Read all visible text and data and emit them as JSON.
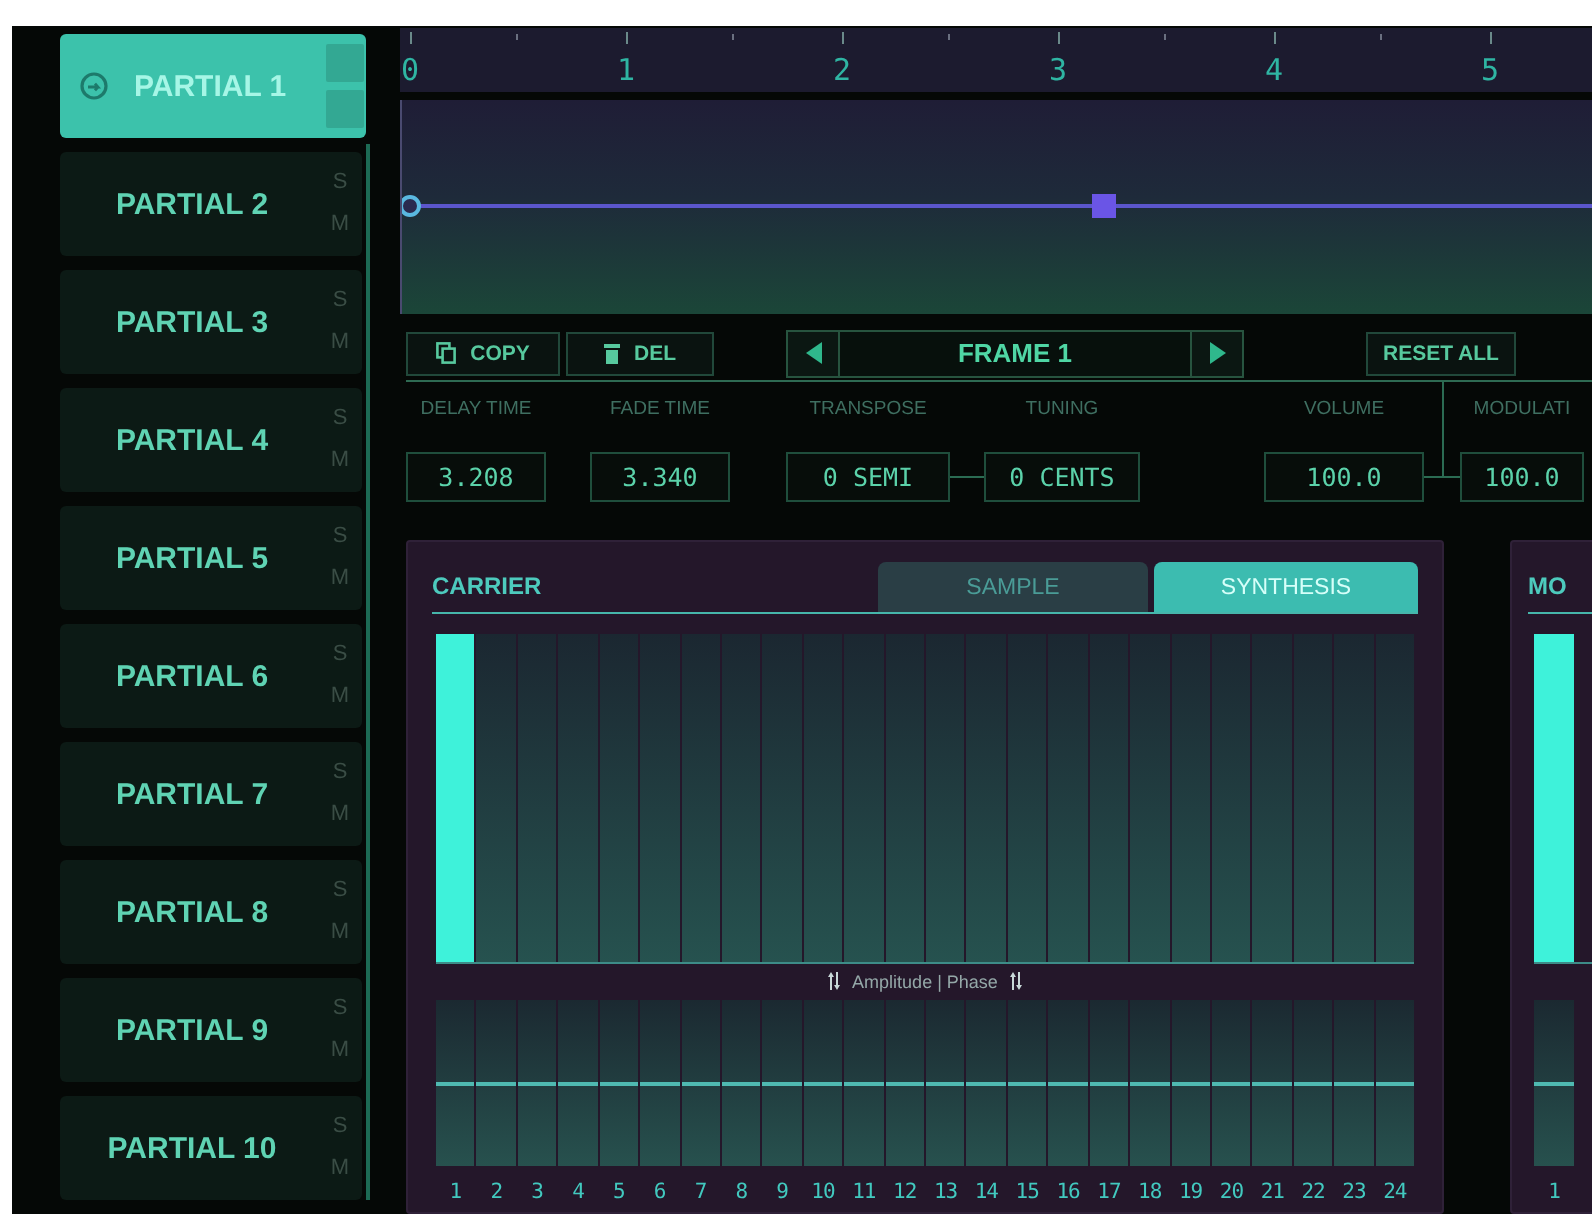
{
  "partials": [
    {
      "label": "PARTIAL 1",
      "selected": true
    },
    {
      "label": "PARTIAL 2",
      "selected": false,
      "toggles": [
        "S",
        "M"
      ]
    },
    {
      "label": "PARTIAL 3",
      "selected": false,
      "toggles": [
        "S",
        "M"
      ]
    },
    {
      "label": "PARTIAL 4",
      "selected": false,
      "toggles": [
        "S",
        "M"
      ]
    },
    {
      "label": "PARTIAL 5",
      "selected": false,
      "toggles": [
        "S",
        "M"
      ]
    },
    {
      "label": "PARTIAL 6",
      "selected": false,
      "toggles": [
        "S",
        "M"
      ]
    },
    {
      "label": "PARTIAL 7",
      "selected": false,
      "toggles": [
        "S",
        "M"
      ]
    },
    {
      "label": "PARTIAL 8",
      "selected": false,
      "toggles": [
        "S",
        "M"
      ]
    },
    {
      "label": "PARTIAL 9",
      "selected": false,
      "toggles": [
        "S",
        "M"
      ]
    },
    {
      "label": "PARTIAL 10",
      "selected": false,
      "toggles": [
        "S",
        "M"
      ]
    }
  ],
  "ruler": {
    "ticks": [
      "0",
      "1",
      "2",
      "3",
      "4",
      "5"
    ]
  },
  "toolbar": {
    "copy": "COPY",
    "delete": "DEL",
    "frame": "FRAME 1",
    "reset": "RESET ALL"
  },
  "params": [
    {
      "label": "DELAY TIME",
      "value": "3.208"
    },
    {
      "label": "FADE TIME",
      "value": "3.340"
    },
    {
      "label": "TRANSPOSE",
      "value": "0 SEMI"
    },
    {
      "label": "TUNING",
      "value": "0 CENTS"
    },
    {
      "label": "VOLUME",
      "value": "100.0"
    },
    {
      "label": "MODULATI",
      "value": "100.0"
    }
  ],
  "carrier": {
    "title": "CARRIER",
    "tabs": [
      {
        "label": "SAMPLE",
        "selected": false
      },
      {
        "label": "SYNTHESIS",
        "selected": true
      }
    ],
    "axis_label": "Amplitude | Phase",
    "harmonics": [
      {
        "label": "1",
        "level": 1
      },
      {
        "label": "2",
        "level": 0
      },
      {
        "label": "3",
        "level": 0
      },
      {
        "label": "4",
        "level": 0
      },
      {
        "label": "5",
        "level": 0
      },
      {
        "label": "6",
        "level": 0
      },
      {
        "label": "7",
        "level": 0
      },
      {
        "label": "8",
        "level": 0
      },
      {
        "label": "9",
        "level": 0
      },
      {
        "label": "10",
        "level": 0
      },
      {
        "label": "11",
        "level": 0
      },
      {
        "label": "12",
        "level": 0
      },
      {
        "label": "13",
        "level": 0
      },
      {
        "label": "14",
        "level": 0
      },
      {
        "label": "15",
        "level": 0
      },
      {
        "label": "16",
        "level": 0
      },
      {
        "label": "17",
        "level": 0
      },
      {
        "label": "18",
        "level": 0
      },
      {
        "label": "19",
        "level": 0
      },
      {
        "label": "20",
        "level": 0
      },
      {
        "label": "21",
        "level": 0
      },
      {
        "label": "22",
        "level": 0
      },
      {
        "label": "23",
        "level": 0
      },
      {
        "label": "24",
        "level": 0
      }
    ],
    "phases": [
      {
        "level": 0.5
      },
      {
        "level": 0.5
      },
      {
        "level": 0.5
      },
      {
        "level": 0.5
      },
      {
        "level": 0.5
      },
      {
        "level": 0.5
      },
      {
        "level": 0.5
      },
      {
        "level": 0.5
      },
      {
        "level": 0.5
      },
      {
        "level": 0.5
      },
      {
        "level": 0.5
      },
      {
        "level": 0.5
      },
      {
        "level": 0.5
      },
      {
        "level": 0.5
      },
      {
        "level": 0.5
      },
      {
        "level": 0.5
      },
      {
        "level": 0.5
      },
      {
        "level": 0.5
      },
      {
        "level": 0.5
      },
      {
        "level": 0.5
      },
      {
        "level": 0.5
      },
      {
        "level": 0.5
      },
      {
        "level": 0.5
      },
      {
        "level": 0.5
      }
    ]
  },
  "modulator": {
    "title": "MO",
    "harmonics": [
      {
        "label": "1",
        "level": 1
      }
    ],
    "phases": [
      {
        "level": 0.5
      }
    ]
  }
}
